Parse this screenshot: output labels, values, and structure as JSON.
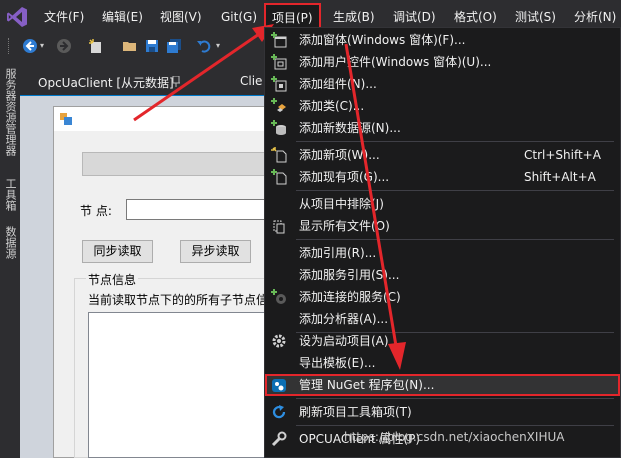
{
  "menubar": {
    "items": [
      "文件(F)",
      "编辑(E)",
      "视图(V)",
      "Git(G)",
      "项目(P)",
      "生成(B)",
      "调试(D)",
      "格式(O)",
      "测试(S)",
      "分析(N)"
    ]
  },
  "sidetabs": [
    "服务器资源管理器",
    "工具箱",
    "数据源"
  ],
  "doc_tabs": [
    "OpcUaClient [从元数据]",
    "Clie"
  ],
  "form": {
    "node_label": "节  点:",
    "sync_read_button": "同步读取",
    "async_read_button": "异步读取",
    "group_title": "节点信息",
    "group_desc": "当前读取节点下的的所有子节点信"
  },
  "project_menu": {
    "items": [
      {
        "label": "添加窗体(Windows 窗体)(F)...",
        "icon": "add-form-icon"
      },
      {
        "label": "添加用户控件(Windows 窗体)(U)...",
        "icon": "add-user-control-icon"
      },
      {
        "label": "添加组件(N)...",
        "icon": "add-component-icon"
      },
      {
        "label": "添加类(C)...",
        "icon": "add-class-icon"
      },
      {
        "label": "添加新数据源(N)...",
        "icon": "add-data-source-icon"
      },
      {
        "label": "添加新项(W)...",
        "shortcut": "Ctrl+Shift+A",
        "icon": "add-new-item-icon"
      },
      {
        "label": "添加现有项(G)...",
        "shortcut": "Shift+Alt+A",
        "icon": "add-existing-item-icon"
      },
      {
        "label": "从项目中排除(J)",
        "icon": ""
      },
      {
        "label": "显示所有文件(O)",
        "icon": "show-all-files-icon"
      },
      {
        "label": "添加引用(R)...",
        "icon": ""
      },
      {
        "label": "添加服务引用(S)...",
        "icon": ""
      },
      {
        "label": "添加连接的服务(C)",
        "icon": "connected-service-icon"
      },
      {
        "label": "添加分析器(A)...",
        "icon": ""
      },
      {
        "label": "设为启动项目(A)",
        "icon": "gear-icon"
      },
      {
        "label": "导出模板(E)...",
        "icon": ""
      },
      {
        "label": "管理 NuGet 程序包(N)...",
        "icon": "nuget-icon"
      },
      {
        "label": "刷新项目工具箱项(T)",
        "icon": "refresh-icon"
      },
      {
        "label": "OPCUAClient 属性(P)",
        "icon": "wrench-icon"
      }
    ]
  },
  "watermark": "https://blog.csdn.net/xiaochenXIHUA",
  "colors": {
    "highlight_border": "#e3262b",
    "menu_bg": "#1b1b1c",
    "chrome_bg": "#2d2d30",
    "accent_purple": "#865fc5"
  }
}
